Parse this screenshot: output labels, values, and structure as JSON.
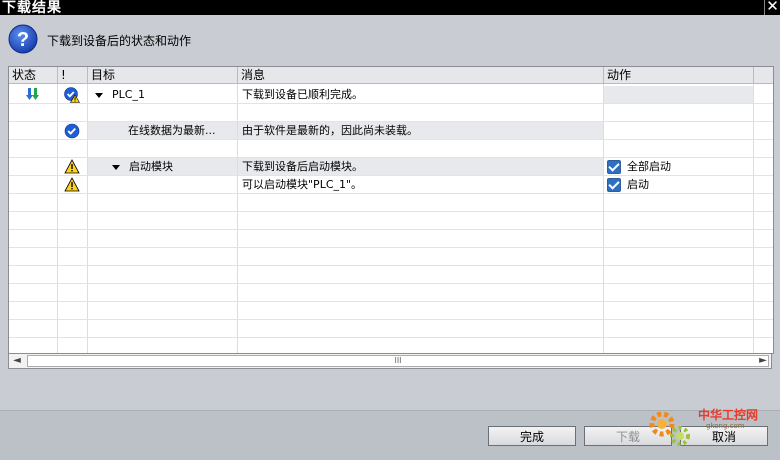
{
  "window": {
    "title": "下载结果",
    "close_glyph": "✕"
  },
  "header": {
    "message": "下载到设备后的状态和动作",
    "icon": "question-icon"
  },
  "table": {
    "columns": [
      "状态",
      "!",
      "目标",
      "消息",
      "动作"
    ],
    "rows": [
      {
        "status_icon": "download-arrows-icon",
        "flag_icon": "check-warning-icon",
        "expand": true,
        "target": "PLC_1",
        "message": "下载到设备已顺利完成。",
        "action": ""
      },
      {
        "status_icon": "",
        "flag_icon": "",
        "expand": false,
        "target": "",
        "message": "",
        "action": ""
      },
      {
        "status_icon": "",
        "flag_icon": "check-circle-icon",
        "expand": false,
        "target": "在线数据为最新...",
        "message": "由于软件是最新的，因此尚未装载。",
        "action": ""
      },
      {
        "status_icon": "",
        "flag_icon": "",
        "expand": false,
        "target": "",
        "message": "",
        "action": ""
      },
      {
        "status_icon": "",
        "flag_icon": "warning-icon",
        "expand": true,
        "target": "启动模块",
        "message": "下载到设备后启动模块。",
        "action": "全部启动",
        "checked": true
      },
      {
        "status_icon": "",
        "flag_icon": "warning-icon",
        "expand": false,
        "target": "",
        "message": "可以启动模块\"PLC_1\"。",
        "action": "启动",
        "checked": true
      }
    ]
  },
  "scrollbar": {
    "left": "◄",
    "right": "►",
    "grip": "III"
  },
  "footer": {
    "finish": "完成",
    "download": "下载",
    "cancel": "取消"
  },
  "watermark": {
    "text": "中华工控网",
    "sub": "gkong.com"
  }
}
